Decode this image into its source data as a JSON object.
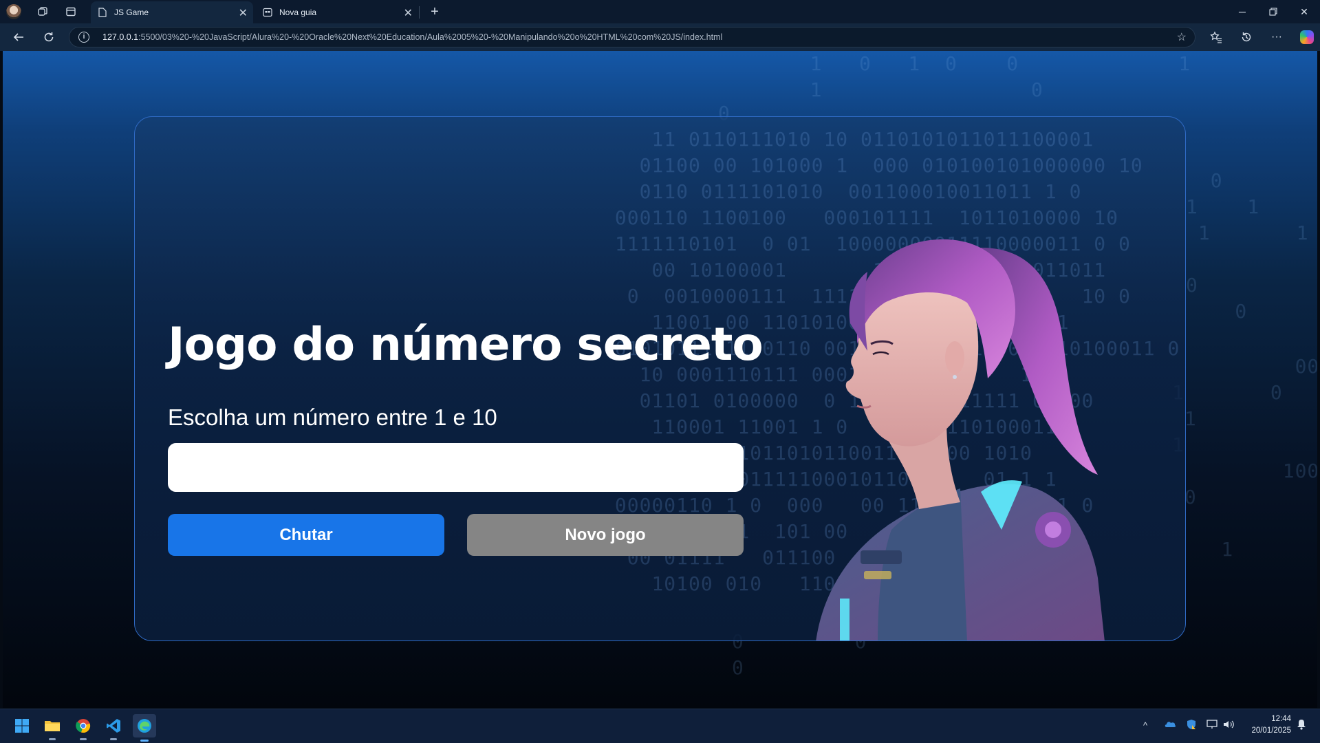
{
  "browser": {
    "tabs": [
      {
        "title": "JS Game",
        "active": true
      },
      {
        "title": "Nova guia",
        "active": false
      }
    ],
    "address": {
      "host": "127.0.0.1",
      "path": ":5500/03%20-%20JavaScript/Alura%20-%20Oracle%20Next%20Education/Aula%2005%20-%20Manipulando%20o%20HTML%20com%20JS/index.html"
    }
  },
  "game": {
    "title": "Jogo do número secreto",
    "prompt": "Escolha um número entre 1 e 10",
    "input_value": "",
    "guess_button": "Chutar",
    "new_game_button": "Novo jogo"
  },
  "taskbar": {
    "time": "12:44",
    "date": "20/01/2025"
  },
  "colors": {
    "primary_button": "#1875e8",
    "secondary_button": "#858585",
    "card_border": "#2f6ac4"
  }
}
